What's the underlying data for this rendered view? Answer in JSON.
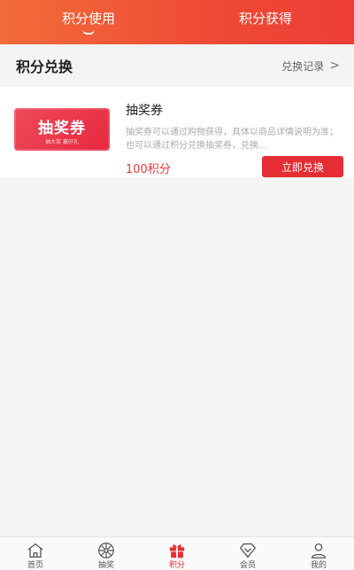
{
  "tabs": [
    {
      "label": "积分使用",
      "active": true
    },
    {
      "label": "积分获得",
      "active": false
    }
  ],
  "section": {
    "title": "积分兑换",
    "link": "兑换记录",
    "chevron": ">"
  },
  "item": {
    "thumb_title": "抽奖券",
    "thumb_sub": "抽大奖 赢好礼",
    "name": "抽奖券",
    "description": "抽奖券可以通过购物获得，具体以商品详情说明为准；也可以通过积分兑换抽奖券，兑换…",
    "price": "100积分",
    "button": "立即兑换"
  },
  "nav": [
    {
      "label": "首页",
      "icon": "home-icon",
      "active": false
    },
    {
      "label": "抽奖",
      "icon": "lottery-wheel-icon",
      "active": false
    },
    {
      "label": "积分",
      "icon": "gift-icon",
      "active": true
    },
    {
      "label": "会员",
      "icon": "diamond-icon",
      "active": false
    },
    {
      "label": "我的",
      "icon": "user-icon",
      "active": false
    }
  ],
  "colors": {
    "header_gradient_start": "#f26c3a",
    "header_gradient_end": "#ec3d36",
    "accent_red": "#e62d34",
    "price_red": "#e8393c"
  }
}
